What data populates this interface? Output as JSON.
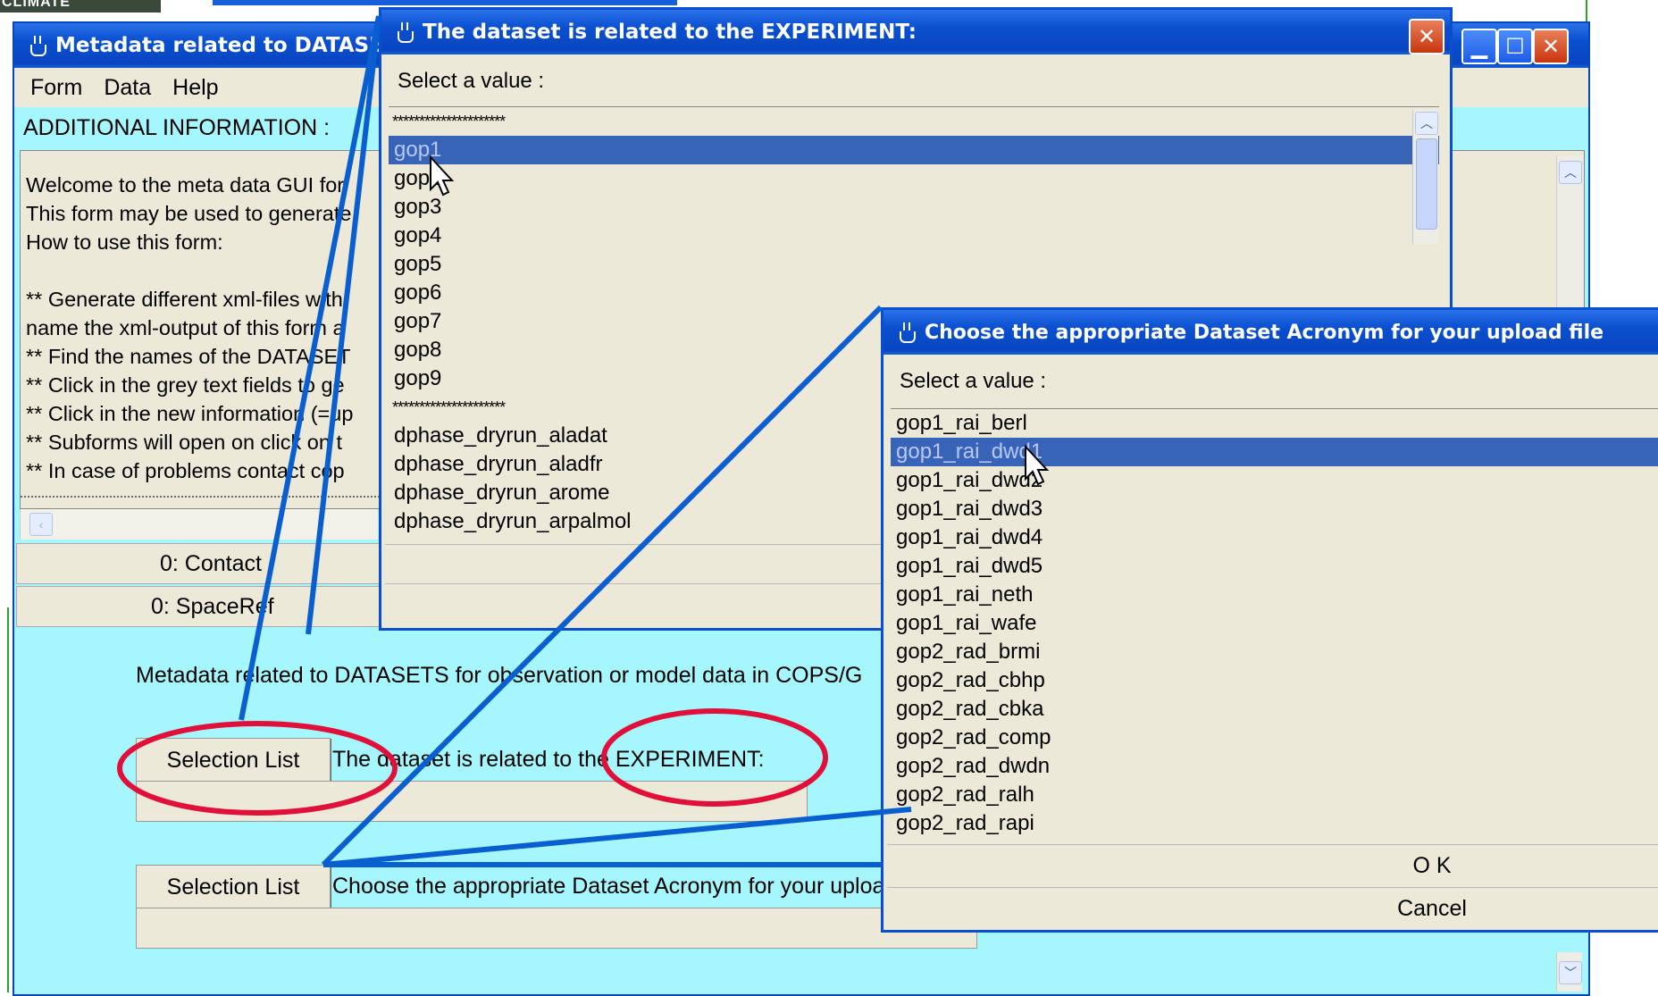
{
  "logo": {
    "text": "CLIMATE"
  },
  "main_window": {
    "title": "Metadata related to DATASETS",
    "menu": [
      "Form",
      "Data",
      "Help"
    ],
    "additional_label": "ADDITIONAL INFORMATION :",
    "text_lines": [
      "Welcome to the meta data GUI for",
      "This form may be used to generate",
      "How to use this form:",
      "",
      "** Generate different xml-files with",
      "name the xml-output of this form a",
      "** Find the names of the DATASET",
      "** Click in the grey text fields to ge",
      "** Click in the new information (=up",
      "** Subforms will open on click on t",
      "** In case of problems contact cop"
    ],
    "contact_button": "0: Contact",
    "spaceref_button": "0: SpaceRef",
    "form_heading": "Metadata related to DATASETS for observation or model data in COPS/G",
    "selection_list_label": "Selection List",
    "experiment_label": "The dataset is related to the EXPERIMENT:",
    "acronym_label": "Choose the appropriate Dataset Acronym for your upload file"
  },
  "dialog_experiment": {
    "title": "The dataset is related to the EXPERIMENT:",
    "prompt": "Select a value :",
    "items": [
      "*********************",
      "gop1",
      "gop2",
      "gop3",
      "gop4",
      "gop5",
      "gop6",
      "gop7",
      "gop8",
      "gop9",
      "*********************",
      "dphase_dryrun_aladat",
      "dphase_dryrun_aladfr",
      "dphase_dryrun_arome",
      "dphase_dryrun_arpalmol"
    ],
    "selected": "gop1"
  },
  "dialog_acronym": {
    "title": "Choose the appropriate Dataset Acronym for your upload file",
    "prompt": "Select a value :",
    "items": [
      "gop1_rai_berl",
      "gop1_rai_dwd1",
      "gop1_rai_dwd2",
      "gop1_rai_dwd3",
      "gop1_rai_dwd4",
      "gop1_rai_dwd5",
      "gop1_rai_neth",
      "gop1_rai_wafe",
      "gop2_rad_brmi",
      "gop2_rad_cbhp",
      "gop2_rad_cbka",
      "gop2_rad_comp",
      "gop2_rad_dwdn",
      "gop2_rad_ralh",
      "gop2_rad_rapi"
    ],
    "selected": "gop1_rai_dwd1",
    "ok": "O K",
    "cancel": "Cancel"
  },
  "colors": {
    "annotation_line": "#0a5fd0",
    "annotation_ellipse": "#e0103a",
    "form_bg": "#a6f7fd",
    "dialog_bg": "#ece9d8"
  }
}
